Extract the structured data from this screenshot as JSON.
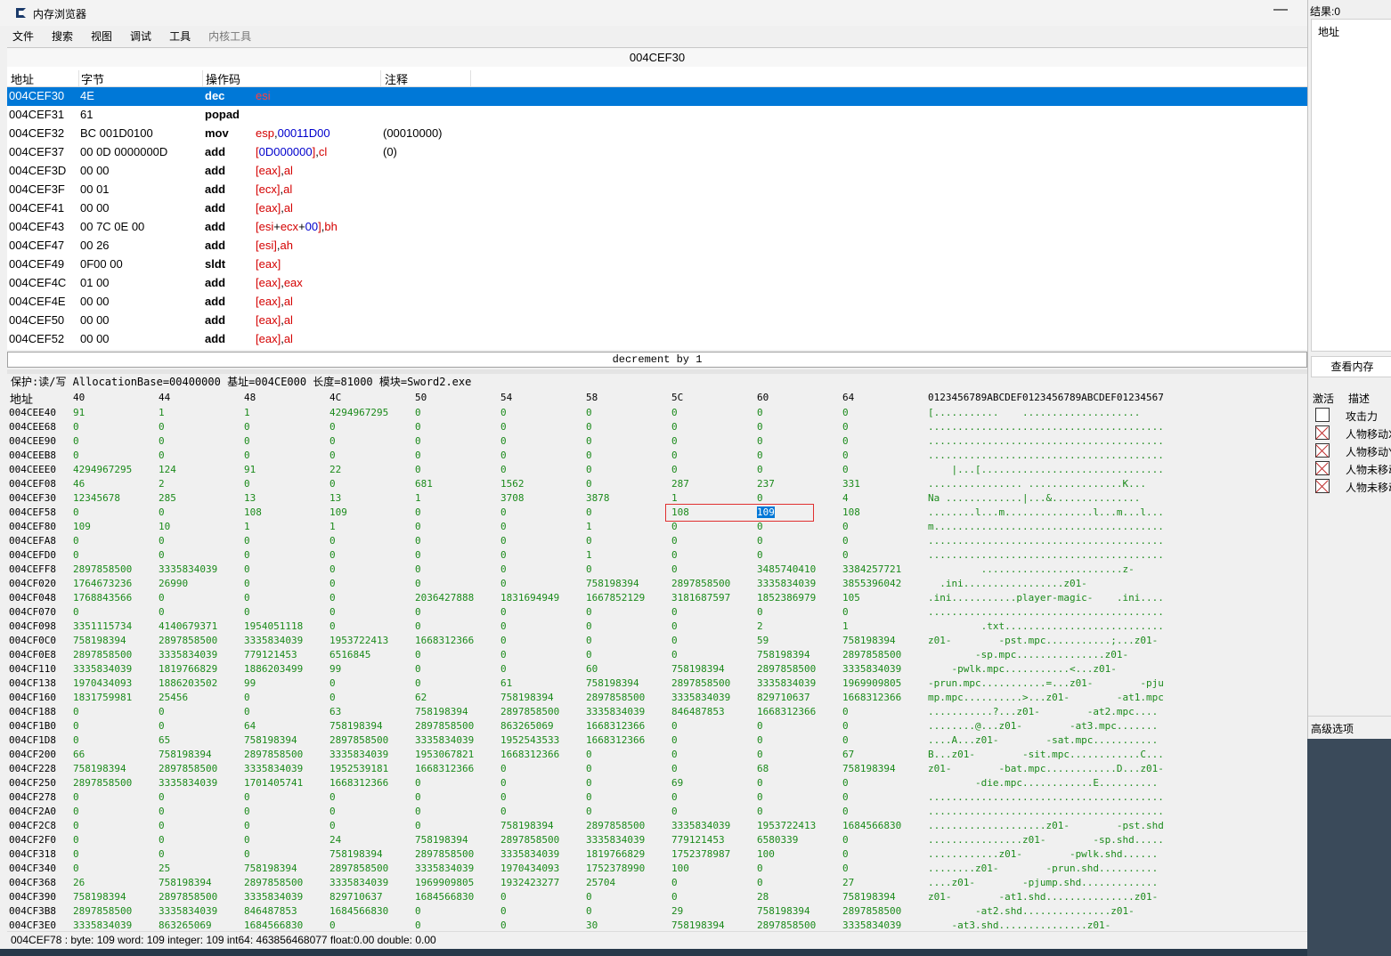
{
  "window": {
    "title": "内存浏览器"
  },
  "menu": [
    "文件",
    "搜索",
    "视图",
    "调试",
    "工具",
    "内核工具"
  ],
  "address_bar": "004CEF30",
  "disassembler": {
    "headers": [
      "地址",
      "字节",
      "操作码",
      "注释"
    ],
    "rows": [
      {
        "addr": "004CEF30",
        "bytes": "4E",
        "op": "dec",
        "args": [
          [
            "esi",
            "r"
          ]
        ],
        "comment": ""
      },
      {
        "addr": "004CEF31",
        "bytes": "61",
        "op": "popad",
        "args": [],
        "comment": ""
      },
      {
        "addr": "004CEF32",
        "bytes": "BC 001D0100",
        "op": "mov",
        "args": [
          [
            "esp",
            "r"
          ],
          [
            ",",
            ""
          ],
          [
            "00011D00",
            "b"
          ]
        ],
        "comment": "(00010000)"
      },
      {
        "addr": "004CEF37",
        "bytes": "00 0D 0000000D",
        "op": "add",
        "args": [
          [
            "[",
            "r"
          ],
          [
            "0D000000",
            "b"
          ],
          [
            "]",
            "r"
          ],
          [
            ",",
            ""
          ],
          [
            "cl",
            "r"
          ]
        ],
        "comment": "(0)"
      },
      {
        "addr": "004CEF3D",
        "bytes": "00 00",
        "op": "add",
        "args": [
          [
            "[eax]",
            "r"
          ],
          [
            ",",
            ""
          ],
          [
            "al",
            "r"
          ]
        ],
        "comment": ""
      },
      {
        "addr": "004CEF3F",
        "bytes": "00 01",
        "op": "add",
        "args": [
          [
            "[ecx]",
            "r"
          ],
          [
            ",",
            ""
          ],
          [
            "al",
            "r"
          ]
        ],
        "comment": ""
      },
      {
        "addr": "004CEF41",
        "bytes": "00 00",
        "op": "add",
        "args": [
          [
            "[eax]",
            "r"
          ],
          [
            ",",
            ""
          ],
          [
            "al",
            "r"
          ]
        ],
        "comment": ""
      },
      {
        "addr": "004CEF43",
        "bytes": "00 7C 0E 00",
        "op": "add",
        "args": [
          [
            "[esi",
            "r"
          ],
          [
            "+",
            ""
          ],
          [
            "ecx",
            "r"
          ],
          [
            "+",
            ""
          ],
          [
            "00",
            "b"
          ],
          [
            "]",
            "r"
          ],
          [
            ",",
            ""
          ],
          [
            "bh",
            "r"
          ]
        ],
        "comment": ""
      },
      {
        "addr": "004CEF47",
        "bytes": "00 26",
        "op": "add",
        "args": [
          [
            "[esi]",
            "r"
          ],
          [
            ",",
            ""
          ],
          [
            "ah",
            "r"
          ]
        ],
        "comment": ""
      },
      {
        "addr": "004CEF49",
        "bytes": "0F00 00",
        "op": "sldt",
        "args": [
          [
            "[eax]",
            "r"
          ]
        ],
        "comment": ""
      },
      {
        "addr": "004CEF4C",
        "bytes": "01 00",
        "op": "add",
        "args": [
          [
            "[eax]",
            "r"
          ],
          [
            ",",
            ""
          ],
          [
            "eax",
            "r"
          ]
        ],
        "comment": ""
      },
      {
        "addr": "004CEF4E",
        "bytes": "00 00",
        "op": "add",
        "args": [
          [
            "[eax]",
            "r"
          ],
          [
            ",",
            ""
          ],
          [
            "al",
            "r"
          ]
        ],
        "comment": ""
      },
      {
        "addr": "004CEF50",
        "bytes": "00 00",
        "op": "add",
        "args": [
          [
            "[eax]",
            "r"
          ],
          [
            ",",
            ""
          ],
          [
            "al",
            "r"
          ]
        ],
        "comment": ""
      },
      {
        "addr": "004CEF52",
        "bytes": "00 00",
        "op": "add",
        "args": [
          [
            "[eax]",
            "r"
          ],
          [
            ",",
            ""
          ],
          [
            "al",
            "r"
          ]
        ],
        "comment": ""
      }
    ]
  },
  "description": "decrement by 1",
  "hexview": {
    "info": "保护:读/写  AllocationBase=00400000 基址=004CE000 长度=81000 模块=Sword2.exe",
    "addr_label": "地址",
    "columns": [
      "40",
      "44",
      "48",
      "4C",
      "50",
      "54",
      "58",
      "5C",
      "60",
      "64"
    ],
    "ascii_header": "0123456789ABCDEF0123456789ABCDEF01234567",
    "rows": [
      {
        "a": "004CEE40",
        "v": [
          "91",
          "1",
          "1",
          "4294967295",
          "0",
          "0",
          "0",
          "0",
          "0",
          "0"
        ],
        "s": "[...........    ...................."
      },
      {
        "a": "004CEE68",
        "v": [
          "0",
          "0",
          "0",
          "0",
          "0",
          "0",
          "0",
          "0",
          "0",
          "0"
        ],
        "s": "........................................"
      },
      {
        "a": "004CEE90",
        "v": [
          "0",
          "0",
          "0",
          "0",
          "0",
          "0",
          "0",
          "0",
          "0",
          "0"
        ],
        "s": "........................................"
      },
      {
        "a": "004CEEB8",
        "v": [
          "0",
          "0",
          "0",
          "0",
          "0",
          "0",
          "0",
          "0",
          "0",
          "0"
        ],
        "s": "........................................"
      },
      {
        "a": "004CEEE0",
        "v": [
          "4294967295",
          "124",
          "91",
          "22",
          "0",
          "0",
          "0",
          "0",
          "0",
          "0"
        ],
        "s": "    |...[..............................."
      },
      {
        "a": "004CEF08",
        "v": [
          "46",
          "2",
          "0",
          "0",
          "681",
          "1562",
          "0",
          "287",
          "237",
          "331"
        ],
        "s": "................ ................K..."
      },
      {
        "a": "004CEF30",
        "v": [
          "12345678",
          "285",
          "13",
          "13",
          "1",
          "3708",
          "3878",
          "1",
          "0",
          "4"
        ],
        "s": "Na .............|...&..............."
      },
      {
        "a": "004CEF58",
        "v": [
          "0",
          "0",
          "108",
          "109",
          "0",
          "0",
          "0",
          "108",
          "109",
          "108"
        ],
        "s": "........l...m...............l...m...l..."
      },
      {
        "a": "004CEF80",
        "v": [
          "109",
          "10",
          "1",
          "1",
          "0",
          "0",
          "1",
          "0",
          "0",
          "0"
        ],
        "s": "m......................................."
      },
      {
        "a": "004CEFA8",
        "v": [
          "0",
          "0",
          "0",
          "0",
          "0",
          "0",
          "0",
          "0",
          "0",
          "0"
        ],
        "s": "........................................"
      },
      {
        "a": "004CEFD0",
        "v": [
          "0",
          "0",
          "0",
          "0",
          "0",
          "0",
          "1",
          "0",
          "0",
          "0"
        ],
        "s": "........................................"
      },
      {
        "a": "004CEFF8",
        "v": [
          "2897858500",
          "3335834039",
          "0",
          "0",
          "0",
          "0",
          "0",
          "0",
          "3485740410",
          "3384257721"
        ],
        "s": "         ........................z-"
      },
      {
        "a": "004CF020",
        "v": [
          "1764673236",
          "26990",
          "0",
          "0",
          "0",
          "0",
          "758198394",
          "2897858500",
          "3335834039",
          "3855396042"
        ],
        "s": "  .ini.................z01-"
      },
      {
        "a": "004CF048",
        "v": [
          "1768843566",
          "0",
          "0",
          "0",
          "2036427888",
          "1831694949",
          "1667852129",
          "3181687597",
          "1852386979",
          "105"
        ],
        "s": ".ini...........player-magic-    .ini...."
      },
      {
        "a": "004CF070",
        "v": [
          "0",
          "0",
          "0",
          "0",
          "0",
          "0",
          "0",
          "0",
          "0",
          "0"
        ],
        "s": "........................................"
      },
      {
        "a": "004CF098",
        "v": [
          "3351115734",
          "4140679371",
          "1954051118",
          "0",
          "0",
          "0",
          "0",
          "0",
          "2",
          "1"
        ],
        "s": "         .txt..........................."
      },
      {
        "a": "004CF0C0",
        "v": [
          "758198394",
          "2897858500",
          "3335834039",
          "1953722413",
          "1668312366",
          "0",
          "0",
          "0",
          "59",
          "758198394"
        ],
        "s": "z01-        -pst.mpc...........;...z01-"
      },
      {
        "a": "004CF0E8",
        "v": [
          "2897858500",
          "3335834039",
          "779121453",
          "6516845",
          "0",
          "0",
          "0",
          "0",
          "758198394",
          "2897858500"
        ],
        "s": "        -sp.mpc...............z01-"
      },
      {
        "a": "004CF110",
        "v": [
          "3335834039",
          "1819766829",
          "1886203499",
          "99",
          "0",
          "0",
          "60",
          "758198394",
          "2897858500",
          "3335834039"
        ],
        "s": "    -pwlk.mpc...........<...z01-"
      },
      {
        "a": "004CF138",
        "v": [
          "1970434093",
          "1886203502",
          "99",
          "0",
          "0",
          "61",
          "758198394",
          "2897858500",
          "3335834039",
          "1969909805"
        ],
        "s": "-prun.mpc...........=...z01-        -pju"
      },
      {
        "a": "004CF160",
        "v": [
          "1831759981",
          "25456",
          "0",
          "0",
          "62",
          "758198394",
          "2897858500",
          "3335834039",
          "829710637",
          "1668312366"
        ],
        "s": "mp.mpc..........>...z01-        -at1.mpc"
      },
      {
        "a": "004CF188",
        "v": [
          "0",
          "0",
          "0",
          "63",
          "758198394",
          "2897858500",
          "3335834039",
          "846487853",
          "1668312366",
          "0"
        ],
        "s": "...........?...z01-        -at2.mpc...."
      },
      {
        "a": "004CF1B0",
        "v": [
          "0",
          "0",
          "64",
          "758198394",
          "2897858500",
          "863265069",
          "1668312366",
          "0",
          "0",
          "0"
        ],
        "s": "........@...z01-        -at3.mpc......."
      },
      {
        "a": "004CF1D8",
        "v": [
          "0",
          "65",
          "758198394",
          "2897858500",
          "3335834039",
          "1952543533",
          "1668312366",
          "0",
          "0",
          "0"
        ],
        "s": "....A...z01-        -sat.mpc..........."
      },
      {
        "a": "004CF200",
        "v": [
          "66",
          "758198394",
          "2897858500",
          "3335834039",
          "1953067821",
          "1668312366",
          "0",
          "0",
          "0",
          "67"
        ],
        "s": "B...z01-        -sit.mpc............C..."
      },
      {
        "a": "004CF228",
        "v": [
          "758198394",
          "2897858500",
          "3335834039",
          "1952539181",
          "1668312366",
          "0",
          "0",
          "0",
          "68",
          "758198394"
        ],
        "s": "z01-        -bat.mpc............D...z01-"
      },
      {
        "a": "004CF250",
        "v": [
          "2897858500",
          "3335834039",
          "1701405741",
          "1668312366",
          "0",
          "0",
          "0",
          "69",
          "0",
          "0"
        ],
        "s": "        -die.mpc............E.........."
      },
      {
        "a": "004CF278",
        "v": [
          "0",
          "0",
          "0",
          "0",
          "0",
          "0",
          "0",
          "0",
          "0",
          "0"
        ],
        "s": "........................................"
      },
      {
        "a": "004CF2A0",
        "v": [
          "0",
          "0",
          "0",
          "0",
          "0",
          "0",
          "0",
          "0",
          "0",
          "0"
        ],
        "s": "........................................"
      },
      {
        "a": "004CF2C8",
        "v": [
          "0",
          "0",
          "0",
          "0",
          "0",
          "758198394",
          "2897858500",
          "3335834039",
          "1953722413",
          "1684566830"
        ],
        "s": "....................z01-        -pst.shd"
      },
      {
        "a": "004CF2F0",
        "v": [
          "0",
          "0",
          "0",
          "24",
          "758198394",
          "2897858500",
          "3335834039",
          "779121453",
          "6580339",
          "0"
        ],
        "s": "................z01-        -sp.shd....."
      },
      {
        "a": "004CF318",
        "v": [
          "0",
          "0",
          "0",
          "758198394",
          "2897858500",
          "3335834039",
          "1819766829",
          "1752378987",
          "100",
          "0"
        ],
        "s": "............z01-        -pwlk.shd......"
      },
      {
        "a": "004CF340",
        "v": [
          "0",
          "25",
          "758198394",
          "2897858500",
          "3335834039",
          "1970434093",
          "1752378990",
          "100",
          "0",
          "0"
        ],
        "s": "........z01-        -prun.shd.........."
      },
      {
        "a": "004CF368",
        "v": [
          "26",
          "758198394",
          "2897858500",
          "3335834039",
          "1969909805",
          "1932423277",
          "25704",
          "0",
          "0",
          "27"
        ],
        "s": "....z01-        -pjump.shd............."
      },
      {
        "a": "004CF390",
        "v": [
          "758198394",
          "2897858500",
          "3335834039",
          "829710637",
          "1684566830",
          "0",
          "0",
          "0",
          "28",
          "758198394"
        ],
        "s": "z01-        -at1.shd...............z01-"
      },
      {
        "a": "004CF3B8",
        "v": [
          "2897858500",
          "3335834039",
          "846487853",
          "1684566830",
          "0",
          "0",
          "0",
          "29",
          "758198394",
          "2897858500"
        ],
        "s": "        -at2.shd...............z01-"
      },
      {
        "a": "004CF3E0",
        "v": [
          "3335834039",
          "863265069",
          "1684566830",
          "0",
          "0",
          "0",
          "30",
          "758198394",
          "2897858500",
          "3335834039"
        ],
        "s": "    -at3.shd...............z01-"
      }
    ]
  },
  "status": "004CEF78 : byte: 109 word: 109 integer: 109 int64: 463856468077 float:0.00 double: 0.00",
  "right_panel": {
    "results": "结果:0",
    "address_header": "地址",
    "view_memory_button": "查看内存",
    "cheat_headers": [
      "激活",
      "描述"
    ],
    "cheats": [
      {
        "label": "攻击力",
        "checked": false
      },
      {
        "label": "人物移动X",
        "checked": true
      },
      {
        "label": "人物移动Y",
        "checked": true
      },
      {
        "label": "人物未移动X",
        "checked": true
      },
      {
        "label": "人物未移动Y",
        "checked": true
      }
    ],
    "advanced": "高级选项"
  }
}
